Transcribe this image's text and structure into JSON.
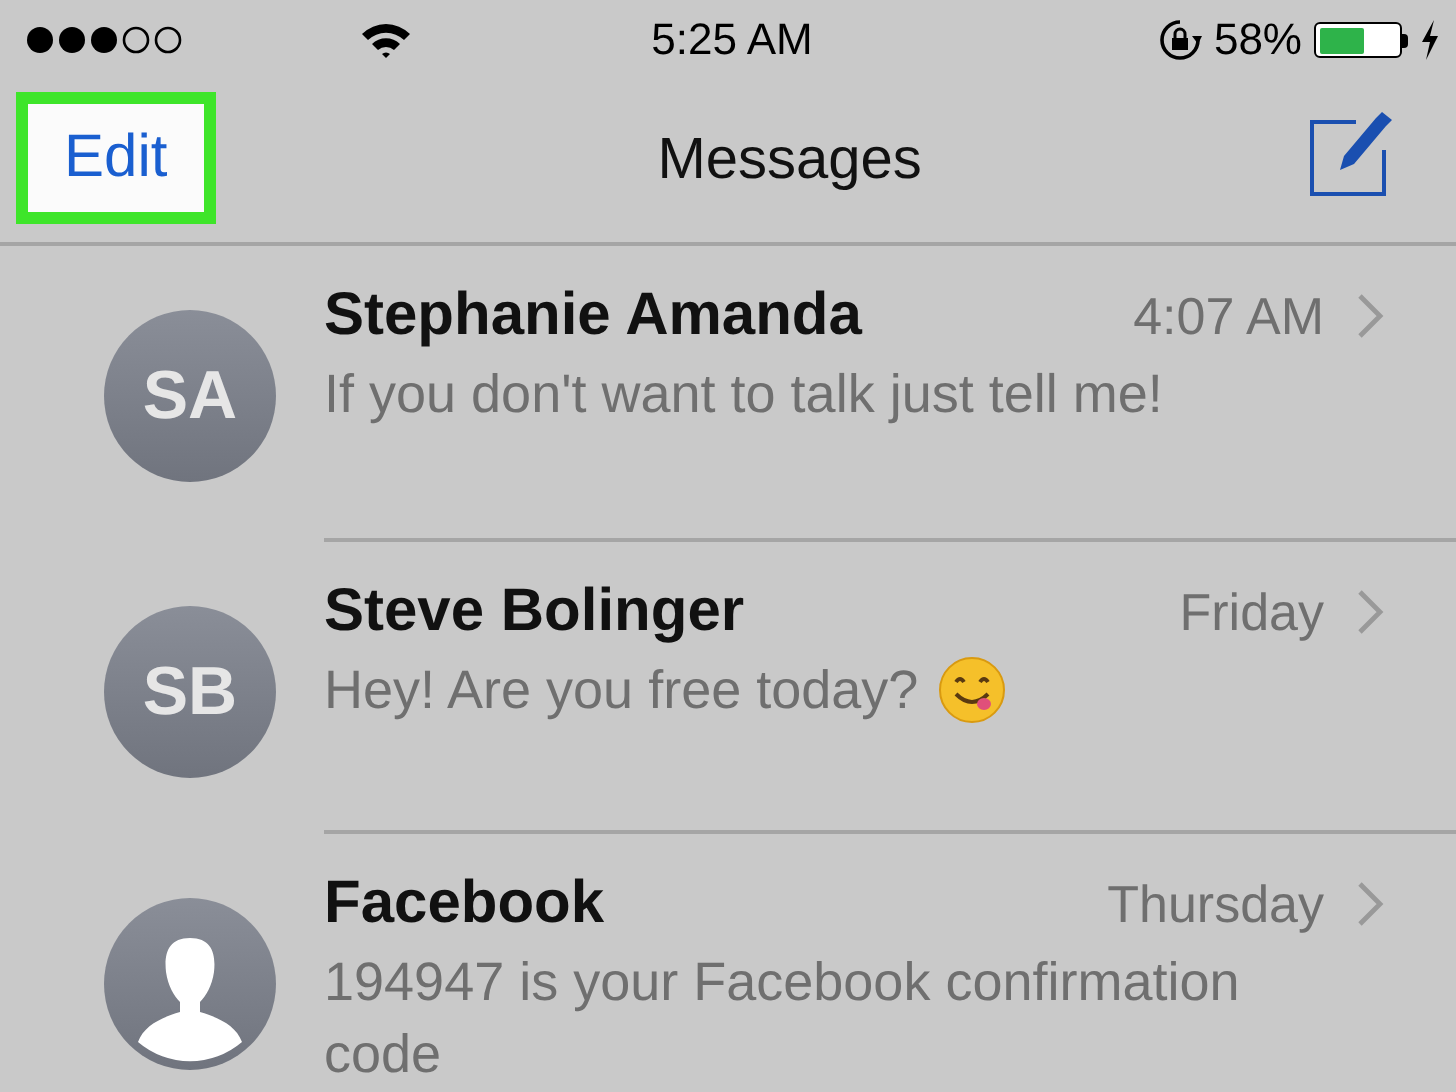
{
  "status_bar": {
    "time": "5:25 AM",
    "battery_percent": "58%"
  },
  "nav_bar": {
    "edit": {
      "label": "Edit",
      "highlighted": true
    },
    "title": "Messages"
  },
  "conversations": [
    {
      "avatar": {
        "kind": "initials",
        "initials": "SA"
      },
      "name": "Stephanie Amanda",
      "time": "4:07 AM",
      "preview": "If you don't want to talk just tell me!",
      "emoji": false
    },
    {
      "avatar": {
        "kind": "initials",
        "initials": "SB"
      },
      "name": "Steve Bolinger",
      "time": "Friday",
      "preview": "Hey! Are you free today?",
      "emoji": true
    },
    {
      "avatar": {
        "kind": "silhouette"
      },
      "name": "Facebook",
      "time": "Thursday",
      "preview": "194947 is your Facebook confirmation code",
      "emoji": false
    }
  ]
}
